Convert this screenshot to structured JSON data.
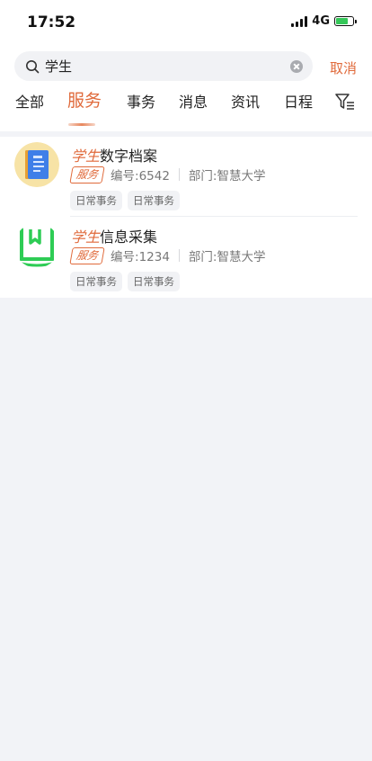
{
  "status_bar": {
    "time": "17:52",
    "network": "4G"
  },
  "search": {
    "query": "学生",
    "cancel_label": "取消"
  },
  "tabs": [
    {
      "label": "全部",
      "active": false
    },
    {
      "label": "服务",
      "active": true
    },
    {
      "label": "事务",
      "active": false
    },
    {
      "label": "消息",
      "active": false
    },
    {
      "label": "资讯",
      "active": false
    },
    {
      "label": "日程",
      "active": false
    }
  ],
  "results": [
    {
      "title_highlight": "学生",
      "title_rest": "数字档案",
      "badge": "服务",
      "code": "编号:6542",
      "department": "部门:智慧大学",
      "tags": [
        "日常事务",
        "日常事务"
      ],
      "icon": "archive-book-icon"
    },
    {
      "title_highlight": "学生",
      "title_rest": "信息采集",
      "badge": "服务",
      "code": "编号:1234",
      "department": "部门:智慧大学",
      "tags": [
        "日常事务",
        "日常事务"
      ],
      "icon": "info-collect-icon"
    }
  ],
  "colors": {
    "accent": "#e06a3b",
    "background": "#f2f3f7"
  }
}
